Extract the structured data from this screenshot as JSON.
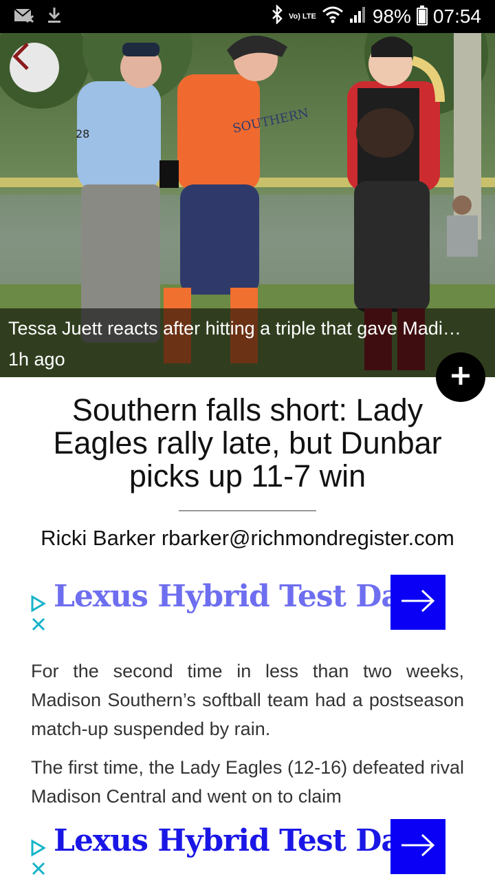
{
  "status_bar": {
    "battery": "98%",
    "time": "07:54",
    "network": "Vo) LTE",
    "battery_level": 0.98,
    "icons": [
      "no-sim-mail-icon",
      "download-icon",
      "bluetooth-icon",
      "volte-icon",
      "wifi-icon",
      "signal-icon",
      "battery-icon"
    ]
  },
  "hero": {
    "caption": "Tessa Juett reacts after hitting a triple that gave Madi…",
    "time_ago": "1h ago",
    "jersey_text": "SOUTHERN",
    "umpire_number": "28"
  },
  "article": {
    "headline": "Southern falls short: Lady Eagles rally late, but Dunbar picks up 11-7 win",
    "byline": "Ricki Barker rbarker@richmondregister.com",
    "paragraph1": "For the second time in less than two weeks, Madison Southern’s softball team had a postseason match-up suspended by rain.",
    "paragraph2": "The first time, the Lady Eagles (12-16) defeated rival Madison Central and went on to claim"
  },
  "ads": [
    {
      "title": "Lexus Hybrid Test Days",
      "color": "#6e6ef0"
    },
    {
      "title": "Lexus Hybrid Test Days",
      "color": "#1a17e6"
    }
  ],
  "colors": {
    "accent": "#0a00f5",
    "ad_marker": "#16b3c8",
    "back_arrow": "#8b1a1a"
  }
}
